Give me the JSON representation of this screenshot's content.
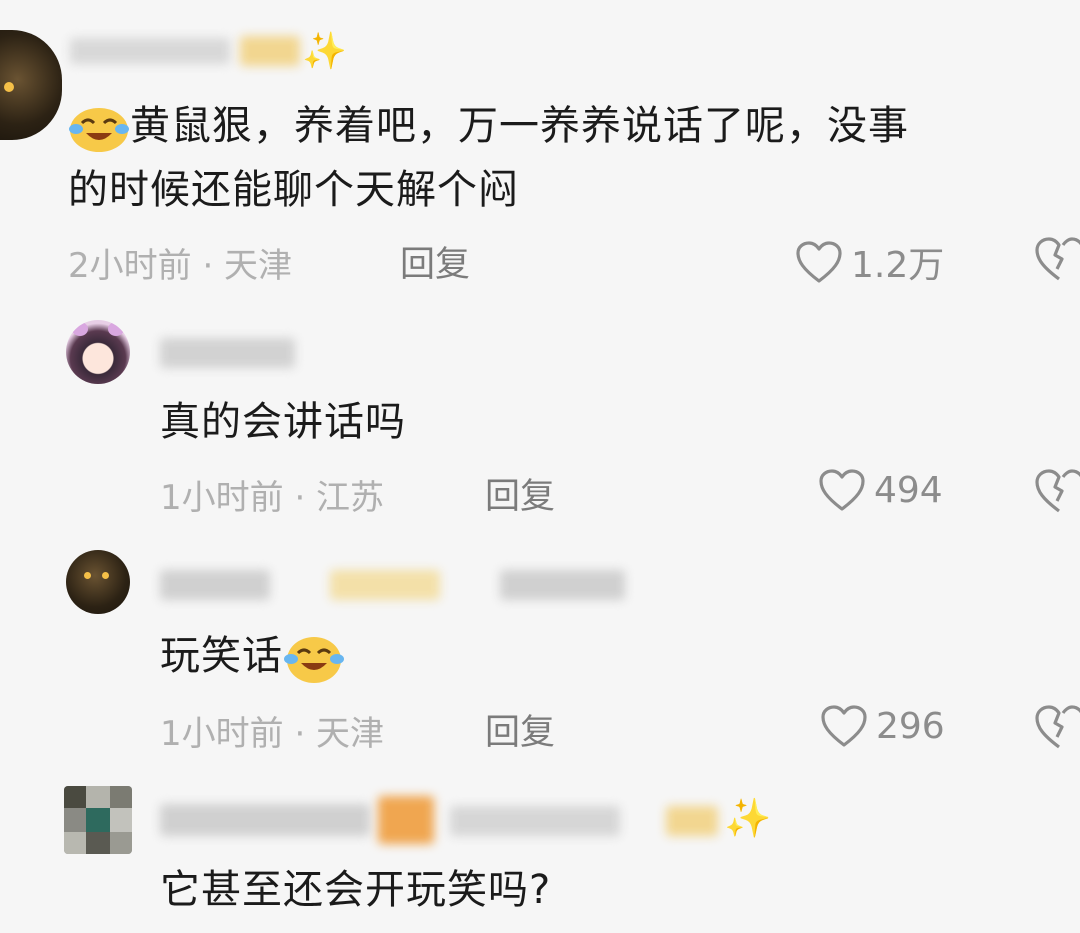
{
  "comments": [
    {
      "text_line1": "黄鼠狠，养着吧，万一养养说话了呢，没事",
      "text_line2": "的时候还能聊个天解个闷",
      "time_location": "2小时前 · 天津",
      "reply_label": "回复",
      "likes": "1.2万"
    },
    {
      "text": "真的会讲话吗",
      "time_location": "1小时前 · 江苏",
      "reply_label": "回复",
      "likes": "494"
    },
    {
      "text": "玩笑话",
      "time_location": "1小时前 · 天津",
      "reply_label": "回复",
      "likes": "296"
    },
    {
      "text": "它甚至还会开玩笑吗?"
    }
  ],
  "icons": {
    "like": "heart-outline-icon",
    "dislike": "broken-heart-icon",
    "emoji": "crying-laughing-emoji"
  },
  "colors": {
    "background": "#f6f6f6",
    "text": "#1b1b1b",
    "meta": "#b0b0b0",
    "icon": "#8c8c8c"
  }
}
